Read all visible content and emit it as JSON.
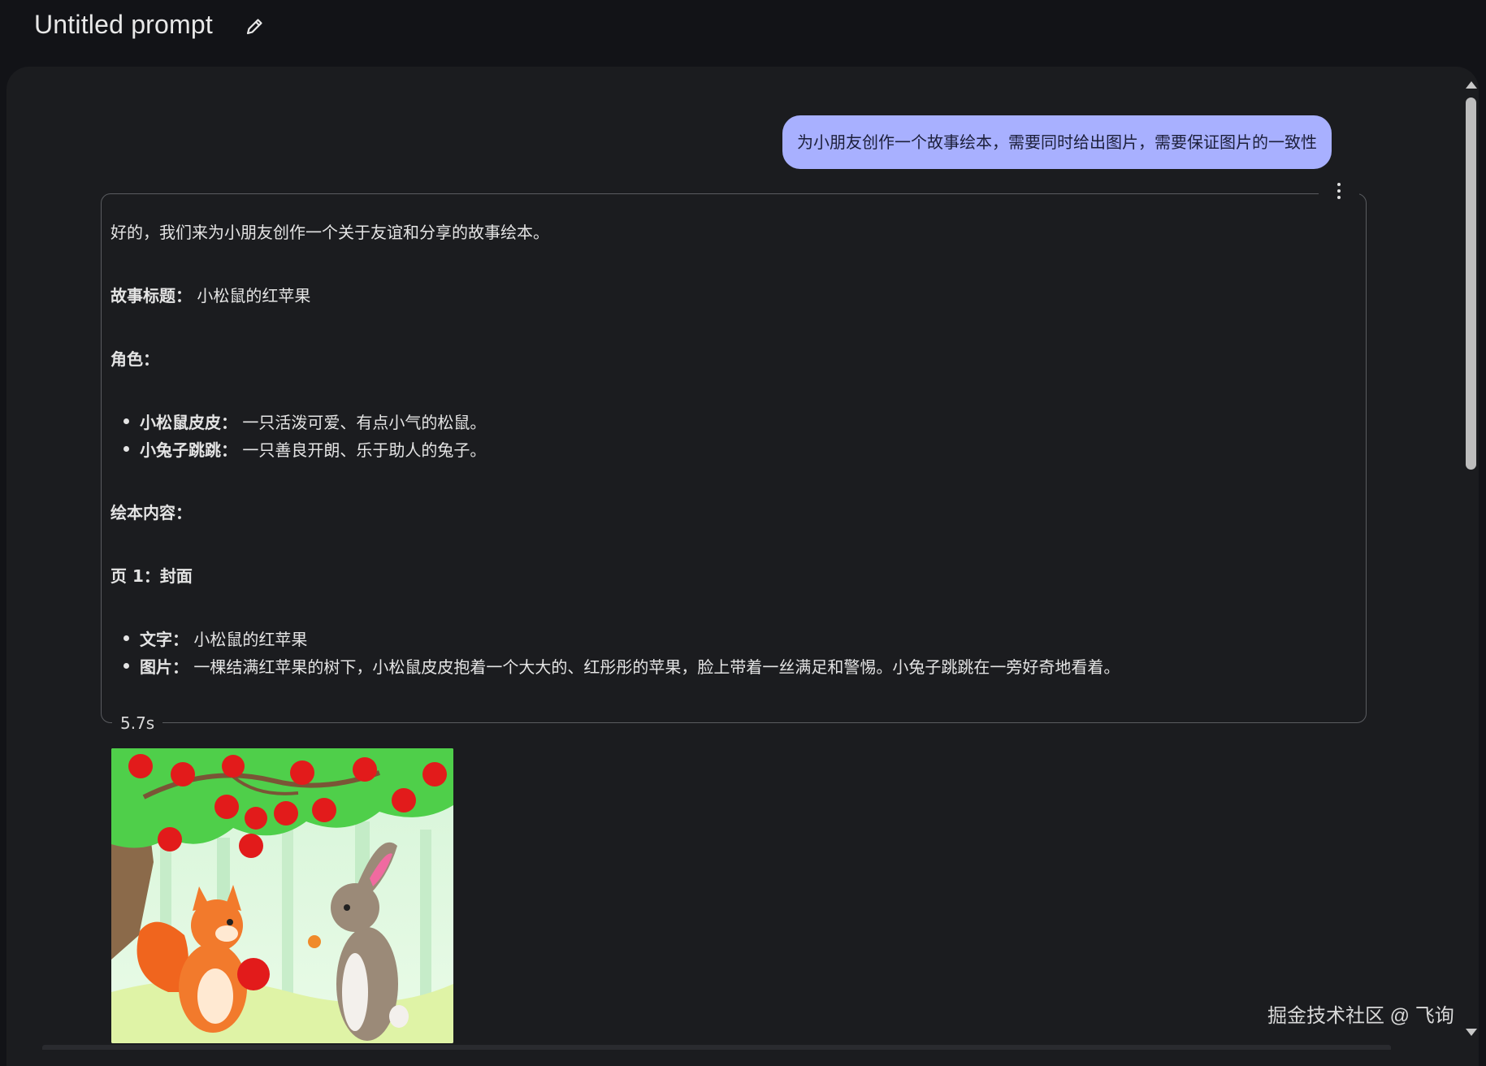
{
  "header": {
    "title": "Untitled prompt"
  },
  "user_message": "为小朋友创作一个故事绘本，需要同时给出图片，需要保证图片的一致性",
  "response": {
    "intro": "好的，我们来为小朋友创作一个关于友谊和分享的故事绘本。",
    "story_title_label": "故事标题：",
    "story_title": "小松鼠的红苹果",
    "characters_heading": "角色：",
    "characters": [
      {
        "name": "小松鼠皮皮：",
        "desc": "一只活泼可爱、有点小气的松鼠。"
      },
      {
        "name": "小兔子跳跳：",
        "desc": "一只善良开朗、乐于助人的兔子。"
      }
    ],
    "content_heading": "绘本内容：",
    "page_heading": "页 1：封面",
    "page_items": [
      {
        "label": "文字：",
        "text": "小松鼠的红苹果"
      },
      {
        "label": "图片：",
        "text": "一棵结满红苹果的树下，小松鼠皮皮抱着一个大大的、红彤彤的苹果，脸上带着一丝满足和警惕。小兔子跳跳在一旁好奇地看着。"
      }
    ],
    "elapsed": "5.7s"
  },
  "watermark": "掘金技术社区 @ 飞询",
  "icons": {
    "edit": "pencil-icon",
    "more": "more-vert-icon"
  },
  "colors": {
    "background": "#121317",
    "panel": "#1b1c1f",
    "user_bubble": "#a8b0ff"
  }
}
